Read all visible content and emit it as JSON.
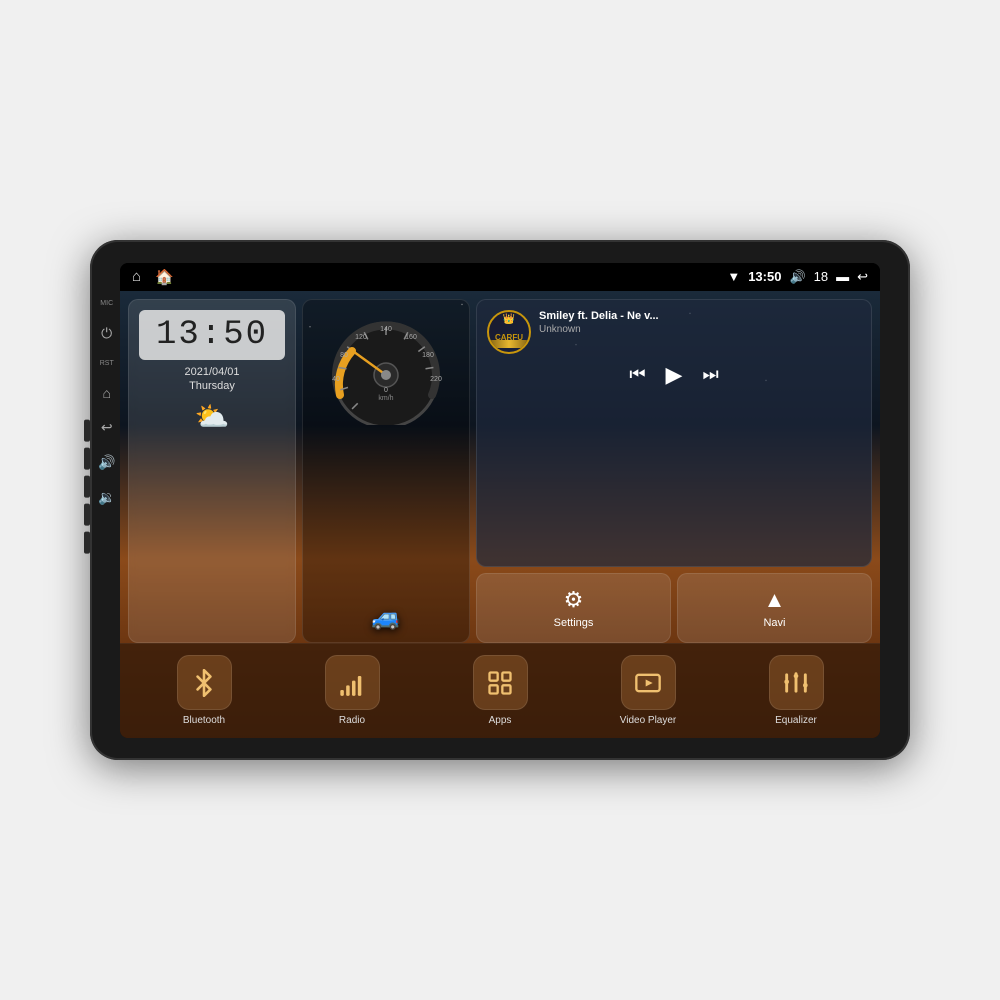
{
  "device": {
    "screen": {
      "status_bar": {
        "wifi_icon": "▼",
        "time": "13:50",
        "volume_icon": "🔊",
        "volume_level": "18",
        "battery_icon": "▬",
        "back_icon": "↩"
      },
      "nav_bar": {
        "home_icon": "⌂",
        "home2_icon": "⌂"
      }
    },
    "clock_widget": {
      "time": "13:50",
      "date": "2021/04/01",
      "day": "Thursday"
    },
    "music_widget": {
      "title": "Smiley ft. Delia - Ne v...",
      "artist": "Unknown",
      "logo_text": "CARFU"
    },
    "settings_widget": {
      "label": "Settings"
    },
    "navi_widget": {
      "label": "Navi"
    },
    "bottom_buttons": [
      {
        "id": "bluetooth",
        "label": "Bluetooth",
        "icon": "bluetooth"
      },
      {
        "id": "radio",
        "label": "Radio",
        "icon": "radio"
      },
      {
        "id": "apps",
        "label": "Apps",
        "icon": "apps"
      },
      {
        "id": "video-player",
        "label": "Video Player",
        "icon": "video"
      },
      {
        "id": "equalizer",
        "label": "Equalizer",
        "icon": "equalizer"
      }
    ],
    "side_labels": {
      "mic": "MIC",
      "rst": "RST"
    }
  }
}
